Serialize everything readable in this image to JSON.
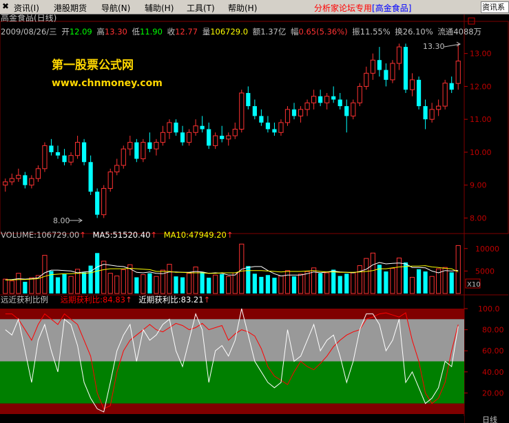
{
  "menu": {
    "close_icon": "close-icon",
    "items": [
      "资讯(I)",
      "港股期货",
      "导航(N)",
      "辅助(H)",
      "工具(T)",
      "帮助(H)"
    ],
    "tag_prefix": "分析家论坛专用",
    "tag_stock": "[高金食品]",
    "right_button": "资讯系"
  },
  "header": {
    "name": "高金食品(日线)",
    "date": "2009/08/26/三",
    "open_label": "开",
    "open": "12.09",
    "high_label": "高",
    "high": "13.30",
    "low_label": "低",
    "low": "11.90",
    "close_label": "收",
    "close": "12.77",
    "vol_label": "量",
    "vol": "106729.0",
    "amount_label": "额",
    "amount": "1.37亿",
    "chg_label": "幅",
    "chg": "0.65(5.36%)",
    "amp_label": "振",
    "amp": "11.55%",
    "turn_label": "换",
    "turn": "26.10%",
    "float_label": "流通",
    "float": "4088万"
  },
  "watermark": {
    "line1": "第一股票公式网",
    "line2": "www.chnmoney.com"
  },
  "annotations": {
    "high_mark": "13.30",
    "low_mark": "8.00"
  },
  "volume_header": {
    "vol": "VOLUME:106729.00",
    "ma5": "MA5:51520.40",
    "ma10": "MA10:47949.20"
  },
  "indicator_header": {
    "name": "远近获利比例",
    "far": "远期获利比:84.83",
    "near": "近期获利比:83.21"
  },
  "bottom_labels": {
    "right": "日线"
  },
  "colors": {
    "up": "#ff3232",
    "down": "#00ffff",
    "ma5": "#ffffff",
    "ma10": "#ffff00",
    "far_line": "#ff0000",
    "near_line": "#ffffff",
    "band_top": "#800000",
    "band_grey": "#999999",
    "band_green": "#007f00",
    "band_bottom": "#800000"
  },
  "chart_data": [
    {
      "type": "candlestick",
      "yaxis": {
        "min": 7.8,
        "max": 13.6,
        "ticks": [
          8.0,
          9.0,
          10.0,
          11.0,
          12.0,
          13.0
        ]
      },
      "ohlc": [
        [
          9.0,
          9.2,
          8.8,
          9.1
        ],
        [
          9.1,
          9.35,
          9.0,
          9.2
        ],
        [
          9.2,
          9.5,
          9.1,
          9.3
        ],
        [
          9.3,
          9.4,
          8.9,
          9.0
        ],
        [
          9.0,
          9.3,
          8.9,
          9.2
        ],
        [
          9.2,
          9.6,
          9.1,
          9.5
        ],
        [
          9.5,
          10.3,
          9.4,
          10.2
        ],
        [
          10.2,
          10.4,
          9.9,
          10.0
        ],
        [
          10.0,
          10.2,
          9.8,
          9.9
        ],
        [
          9.9,
          10.1,
          9.6,
          9.7
        ],
        [
          9.7,
          10.0,
          9.6,
          9.9
        ],
        [
          9.9,
          10.5,
          9.8,
          10.3
        ],
        [
          10.3,
          10.4,
          9.6,
          9.7
        ],
        [
          9.7,
          9.9,
          8.7,
          8.8
        ],
        [
          8.8,
          8.9,
          8.0,
          8.1
        ],
        [
          8.1,
          9.0,
          8.0,
          8.9
        ],
        [
          8.9,
          9.5,
          8.8,
          9.4
        ],
        [
          9.4,
          9.8,
          9.3,
          9.6
        ],
        [
          9.6,
          10.2,
          9.5,
          10.1
        ],
        [
          10.1,
          10.5,
          9.9,
          10.3
        ],
        [
          10.3,
          10.4,
          9.7,
          9.8
        ],
        [
          9.8,
          10.4,
          9.7,
          10.3
        ],
        [
          10.3,
          10.6,
          10.0,
          10.1
        ],
        [
          10.1,
          10.4,
          9.9,
          10.3
        ],
        [
          10.3,
          10.8,
          10.2,
          10.6
        ],
        [
          10.6,
          11.0,
          10.4,
          10.9
        ],
        [
          10.9,
          11.0,
          10.5,
          10.6
        ],
        [
          10.6,
          10.8,
          10.2,
          10.3
        ],
        [
          10.3,
          10.7,
          10.2,
          10.6
        ],
        [
          10.6,
          11.0,
          10.5,
          10.8
        ],
        [
          10.8,
          11.1,
          10.6,
          10.7
        ],
        [
          10.7,
          10.9,
          10.1,
          10.2
        ],
        [
          10.2,
          10.6,
          10.1,
          10.5
        ],
        [
          10.5,
          10.8,
          10.3,
          10.4
        ],
        [
          10.4,
          10.6,
          10.2,
          10.5
        ],
        [
          10.5,
          10.9,
          10.4,
          10.7
        ],
        [
          10.7,
          11.9,
          10.6,
          11.8
        ],
        [
          11.8,
          12.0,
          11.3,
          11.4
        ],
        [
          11.4,
          11.6,
          11.0,
          11.1
        ],
        [
          11.1,
          11.3,
          10.8,
          10.9
        ],
        [
          10.9,
          11.1,
          10.6,
          10.7
        ],
        [
          10.7,
          10.9,
          10.5,
          10.6
        ],
        [
          10.6,
          11.0,
          10.5,
          10.9
        ],
        [
          10.9,
          11.4,
          10.8,
          11.3
        ],
        [
          11.3,
          11.5,
          11.0,
          11.1
        ],
        [
          11.1,
          11.4,
          10.9,
          11.3
        ],
        [
          11.3,
          11.6,
          11.1,
          11.5
        ],
        [
          11.5,
          11.9,
          11.3,
          11.7
        ],
        [
          11.7,
          11.9,
          11.4,
          11.5
        ],
        [
          11.5,
          11.8,
          11.3,
          11.7
        ],
        [
          11.7,
          12.0,
          11.5,
          11.6
        ],
        [
          11.6,
          11.8,
          11.3,
          11.4
        ],
        [
          11.4,
          11.6,
          10.6,
          11.1
        ],
        [
          11.1,
          11.6,
          11.0,
          11.5
        ],
        [
          11.5,
          12.1,
          11.4,
          12.0
        ],
        [
          12.0,
          12.6,
          11.9,
          12.4
        ],
        [
          12.4,
          13.0,
          12.2,
          12.8
        ],
        [
          12.8,
          13.2,
          12.3,
          12.5
        ],
        [
          12.5,
          12.7,
          12.0,
          12.2
        ],
        [
          12.2,
          12.8,
          12.1,
          12.7
        ],
        [
          12.7,
          13.3,
          12.5,
          13.2
        ],
        [
          13.2,
          13.3,
          11.8,
          11.9
        ],
        [
          11.9,
          12.4,
          11.7,
          12.2
        ],
        [
          12.2,
          12.3,
          11.3,
          11.4
        ],
        [
          11.4,
          11.6,
          10.7,
          11.0
        ],
        [
          11.0,
          11.5,
          10.9,
          11.3
        ],
        [
          11.3,
          11.6,
          11.1,
          11.4
        ],
        [
          11.4,
          12.2,
          11.3,
          12.1
        ],
        [
          12.1,
          12.3,
          11.8,
          11.9
        ],
        [
          12.09,
          13.3,
          11.9,
          12.77
        ]
      ]
    },
    {
      "type": "bar",
      "series": [
        {
          "name": "VOLUME",
          "values": [
            3200,
            2800,
            4500,
            2600,
            3500,
            4000,
            8500,
            5000,
            3600,
            4300,
            3800,
            5400,
            4700,
            6200,
            9000,
            7200,
            4500,
            3900,
            5300,
            6400,
            3600,
            4200,
            4500,
            3800,
            5200,
            6500,
            3800,
            3600,
            4500,
            5900,
            4800,
            3500,
            4100,
            4300,
            3800,
            4600,
            11000,
            6100,
            4400,
            3700,
            4100,
            3500,
            3900,
            5100,
            3800,
            4300,
            4900,
            5700,
            4500,
            4600,
            5300,
            3900,
            4400,
            4600,
            6200,
            7800,
            9000,
            6400,
            4900,
            5600,
            7900,
            6900,
            3600,
            5400,
            4900,
            3800,
            5500,
            5800,
            4700,
            10672.9
          ]
        },
        {
          "name": "MA5",
          "values": [
            3000,
            3100,
            3300,
            3200,
            3300,
            3500,
            4600,
            5200,
            5200,
            5100,
            5000,
            4600,
            4800,
            4900,
            5900,
            6500,
            6300,
            6100,
            6000,
            5500,
            4700,
            4600,
            4800,
            4500,
            4400,
            4800,
            4800,
            4700,
            4700,
            4900,
            4800,
            4500,
            4600,
            4500,
            4100,
            4100,
            5400,
            5800,
            6000,
            6000,
            5100,
            4400,
            3900,
            4100,
            4100,
            4100,
            4400,
            4800,
            4600,
            4800,
            5000,
            4800,
            4700,
            4600,
            4900,
            5400,
            6400,
            6900,
            6600,
            6700,
            6800,
            6600,
            5800,
            5800,
            5700,
            5000,
            4600,
            5100,
            5000,
            5152.04
          ]
        },
        {
          "name": "MA10",
          "values": [
            3000,
            3000,
            3100,
            3100,
            3200,
            3300,
            3800,
            4200,
            4300,
            4400,
            4400,
            4500,
            4500,
            4600,
            5000,
            5300,
            5500,
            5500,
            5500,
            5600,
            5500,
            5400,
            5300,
            4900,
            4900,
            4900,
            4700,
            4700,
            4600,
            4600,
            4600,
            4500,
            4500,
            4600,
            4600,
            4600,
            5000,
            5100,
            5100,
            5100,
            5000,
            4900,
            4800,
            4900,
            4900,
            4900,
            5000,
            5100,
            4900,
            4800,
            4800,
            4700,
            4700,
            4700,
            4800,
            4900,
            5100,
            5500,
            5500,
            5700,
            5900,
            6000,
            6100,
            6100,
            6200,
            5900,
            5800,
            5600,
            5500,
            4794.92
          ]
        }
      ],
      "yaxis": {
        "ticks": [
          5000,
          10000
        ],
        "unit_label": "X10"
      }
    },
    {
      "type": "line",
      "series": [
        {
          "name": "远期获利比",
          "values": [
            95,
            95,
            90,
            80,
            70,
            85,
            95,
            90,
            85,
            95,
            90,
            85,
            70,
            55,
            20,
            5,
            8,
            40,
            60,
            70,
            75,
            80,
            85,
            80,
            78,
            82,
            86,
            84,
            80,
            82,
            86,
            80,
            82,
            84,
            70,
            76,
            80,
            78,
            74,
            62,
            45,
            36,
            32,
            28,
            40,
            50,
            45,
            42,
            48,
            55,
            64,
            70,
            75,
            78,
            80,
            90,
            92,
            95,
            96,
            94,
            92,
            96,
            70,
            50,
            20,
            10,
            15,
            30,
            60,
            84.83
          ]
        },
        {
          "name": "近期获利比",
          "values": [
            80,
            75,
            90,
            60,
            30,
            70,
            85,
            60,
            40,
            90,
            85,
            65,
            30,
            15,
            5,
            2,
            30,
            60,
            75,
            85,
            50,
            80,
            70,
            75,
            85,
            90,
            60,
            45,
            70,
            95,
            80,
            30,
            60,
            65,
            55,
            70,
            100,
            75,
            50,
            40,
            30,
            25,
            30,
            80,
            50,
            55,
            70,
            85,
            60,
            70,
            75,
            55,
            30,
            50,
            80,
            95,
            95,
            85,
            60,
            70,
            90,
            30,
            40,
            25,
            10,
            15,
            25,
            50,
            45,
            83.21
          ]
        }
      ],
      "yaxis": {
        "min": 0,
        "max": 100,
        "ticks": [
          20.0,
          40.0,
          60.0,
          80.0,
          100.0
        ]
      },
      "bands": [
        100,
        90,
        50,
        10,
        0
      ]
    }
  ]
}
